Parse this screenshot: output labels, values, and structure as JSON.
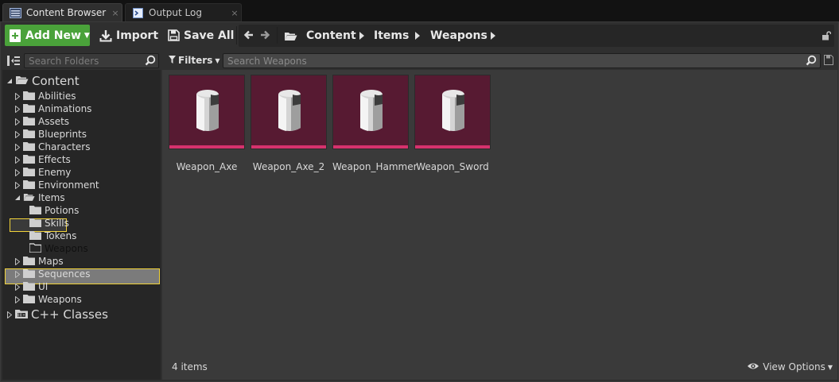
{
  "tabs": [
    {
      "label": "Content Browser",
      "icon": "content-browser-icon",
      "close": "×"
    },
    {
      "label": "Output Log",
      "icon": "output-log-icon",
      "close": "×"
    }
  ],
  "toolbar": {
    "add_new": "Add New",
    "import": "Import",
    "save_all": "Save All"
  },
  "breadcrumbs": [
    "Content",
    "Items",
    "Weapons"
  ],
  "sidebar": {
    "search_placeholder": "Search Folders",
    "root": "Content",
    "folders": [
      "Abilities",
      "Animations",
      "Assets",
      "Blueprints",
      "Characters",
      "Effects",
      "Enemy",
      "Environment",
      "Items"
    ],
    "items_children": [
      "Potions",
      "Skills",
      "Tokens",
      "Weapons"
    ],
    "folders_after": [
      "Maps",
      "Sequences",
      "UI",
      "Weapons"
    ],
    "cpp": "C++ Classes"
  },
  "assets_panel": {
    "filters_label": "Filters",
    "search_placeholder": "Search Weapons",
    "assets": [
      "Weapon_Axe",
      "Weapon_Axe_2",
      "Weapon_Hammer",
      "Weapon_Sword"
    ],
    "count": "4 items",
    "view_options": "View Options"
  },
  "colors": {
    "add_button": "#4aa23a",
    "thumbnail_bg": "#571a32",
    "thumbnail_bar": "#d6326d",
    "selection_border": "#f2d33a"
  }
}
